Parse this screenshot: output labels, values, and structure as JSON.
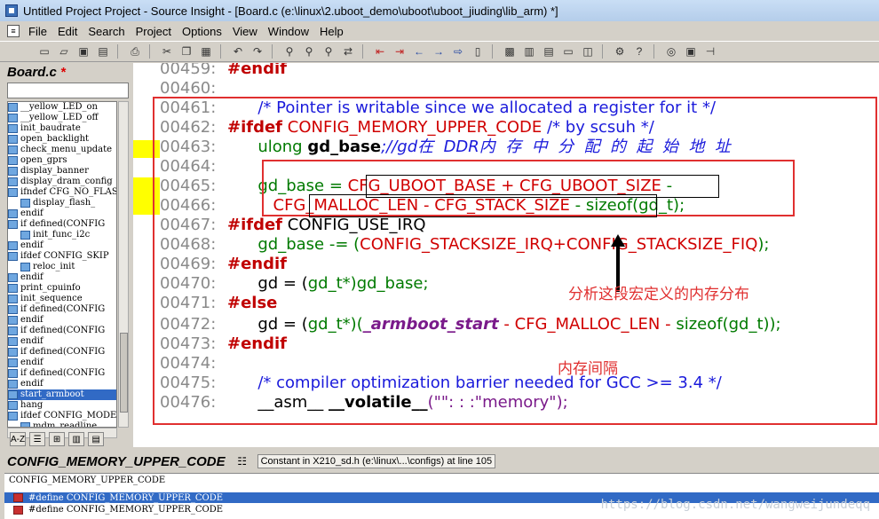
{
  "window": {
    "title": "Untitled Project Project - Source Insight - [Board.c (e:\\linux\\2.uboot_demo\\uboot\\uboot_jiuding\\lib_arm) *]"
  },
  "menu": [
    "File",
    "Edit",
    "Search",
    "Project",
    "Options",
    "View",
    "Window",
    "Help"
  ],
  "toolbar_icons": [
    "new-file-icon",
    "open-icon",
    "save-icon",
    "save-all-icon",
    "print-icon",
    "cut-icon",
    "copy-icon",
    "paste-icon",
    "undo-icon",
    "redo-icon",
    "find-icon",
    "find-next-icon",
    "find-prev-icon",
    "replace-icon",
    "back-icon",
    "forward-icon",
    "jump-icon",
    "bookmark-icon",
    "browse-icon",
    "lookup-icon",
    "context-icon",
    "relation-icon",
    "help-icon"
  ],
  "left_panel": {
    "file_name": "Board.c",
    "modified_mark": "*",
    "symbols": [
      {
        "label": "__yellow_LED_on",
        "indent": false,
        "selected": false
      },
      {
        "label": "__yellow_LED_off",
        "indent": false,
        "selected": false
      },
      {
        "label": "init_baudrate",
        "indent": false,
        "selected": false
      },
      {
        "label": "open_backlight",
        "indent": false,
        "selected": false
      },
      {
        "label": "check_menu_update",
        "indent": false,
        "selected": false
      },
      {
        "label": "open_gprs",
        "indent": false,
        "selected": false
      },
      {
        "label": "display_banner",
        "indent": false,
        "selected": false
      },
      {
        "label": "display_dram_config",
        "indent": false,
        "selected": false
      },
      {
        "label": "ifndef CFG_NO_FLASH",
        "indent": false,
        "selected": false
      },
      {
        "label": "display_flash_",
        "indent": true,
        "selected": false
      },
      {
        "label": "endif",
        "indent": false,
        "selected": false
      },
      {
        "label": "if defined(CONFIG",
        "indent": false,
        "selected": false
      },
      {
        "label": "init_func_i2c",
        "indent": true,
        "selected": false
      },
      {
        "label": "endif",
        "indent": false,
        "selected": false
      },
      {
        "label": "ifdef CONFIG_SKIP",
        "indent": false,
        "selected": false
      },
      {
        "label": "reloc_init",
        "indent": true,
        "selected": false
      },
      {
        "label": "endif",
        "indent": false,
        "selected": false
      },
      {
        "label": "print_cpuinfo",
        "indent": false,
        "selected": false
      },
      {
        "label": "init_sequence",
        "indent": false,
        "selected": false
      },
      {
        "label": "if defined(CONFIG",
        "indent": false,
        "selected": false
      },
      {
        "label": "endif",
        "indent": false,
        "selected": false
      },
      {
        "label": "if defined(CONFIG",
        "indent": false,
        "selected": false
      },
      {
        "label": "endif",
        "indent": false,
        "selected": false
      },
      {
        "label": "if defined(CONFIG",
        "indent": false,
        "selected": false
      },
      {
        "label": "endif",
        "indent": false,
        "selected": false
      },
      {
        "label": "if defined(CONFIG",
        "indent": false,
        "selected": false
      },
      {
        "label": "endif",
        "indent": false,
        "selected": false
      },
      {
        "label": "start_armboot",
        "indent": false,
        "selected": true
      },
      {
        "label": "hang",
        "indent": false,
        "selected": false
      },
      {
        "label": "ifdef CONFIG_MODEM",
        "indent": false,
        "selected": false
      },
      {
        "label": "mdm_readline",
        "indent": true,
        "selected": false
      }
    ],
    "sort_label": "A-Z"
  },
  "editor": {
    "lines": [
      {
        "no": "00459:"
      },
      {
        "no": "00460:"
      },
      {
        "no": "00461:"
      },
      {
        "no": "00462:"
      },
      {
        "no": "00463:"
      },
      {
        "no": "00464:"
      },
      {
        "no": "00465:"
      },
      {
        "no": "00466:"
      },
      {
        "no": "00467:"
      },
      {
        "no": "00468:"
      },
      {
        "no": "00469:"
      },
      {
        "no": "00470:"
      },
      {
        "no": "00471:"
      },
      {
        "no": "00472:"
      },
      {
        "no": "00473:"
      },
      {
        "no": "00474:"
      },
      {
        "no": "00475:"
      },
      {
        "no": "00476:"
      }
    ],
    "code": {
      "l459": "#endif",
      "l461": "/* Pointer is writable since we allocated a register for it */",
      "l462_kw": "#ifdef",
      "l462_mac": "CONFIG_MEMORY_UPPER_CODE",
      "l462_cm": "/* by scsuh */",
      "l463_ty": "ulong",
      "l463_id": "gd_base",
      "l463_cm": ";//gd在  DDR内  存  中  分  配  的  起  始  地  址",
      "l465_a": "gd_base = ",
      "l465_m1": "CFG_UBOOT_BASE",
      "l465_plus": " + ",
      "l465_m2": "CFG_UBOOT_SIZE",
      "l465_tail": " -",
      "l466_m1": "CFG_MALLOC_LEN",
      "l466_minus": " - ",
      "l466_m2": "CFG_STACK_SIZE",
      "l466_tail1": " - ",
      "l466_fn": "sizeof",
      "l466_tail2": "(gd_t);",
      "l467_kw": "#ifdef",
      "l467_id": "CONFIG_USE_IRQ",
      "l468_a": "gd_base -= (",
      "l468_m1": "CONFIG_STACKSIZE_IRQ",
      "l468_op": "+",
      "l468_m2": "CONFIG_STACKSIZE_FIQ",
      "l468_tail": ");",
      "l469": "#endif",
      "l470_a": "gd = (",
      "l470_b": "gd_t*",
      "l470_c": ")gd_base;",
      "l471": "#else",
      "l472_a": "gd = (",
      "l472_b": "gd_t*",
      "l472_c": ")(",
      "l472_fn": "_armboot_start",
      "l472_d": " - ",
      "l472_m": "CFG_MALLOC_LEN",
      "l472_e": " - ",
      "l472_sz": "sizeof",
      "l472_f": "(gd_t));",
      "l473": "#endif",
      "l475": "/* compiler optimization barrier needed for GCC >= 3.4 */",
      "l476_a": "__asm__ ",
      "l476_b": "__volatile__",
      "l476_c": "(\"\": : :\"memory\");"
    },
    "annotation1": "分析这段宏定义的内存分布",
    "annotation2": "内存间隔"
  },
  "context": {
    "symbol": "CONFIG_MEMORY_UPPER_CODE",
    "location": "Constant in X210_sd.h (e:\\linux\\...\\configs) at line 105",
    "lines": [
      "CONFIG_MEMORY_UPPER_CODE",
      "#define CONFIG_MEMORY_UPPER_CODE",
      "#define CONFIG_MEMORY_UPPER_CODE"
    ]
  },
  "watermark": "https://blog.csdn.net/wangweijundeqq"
}
